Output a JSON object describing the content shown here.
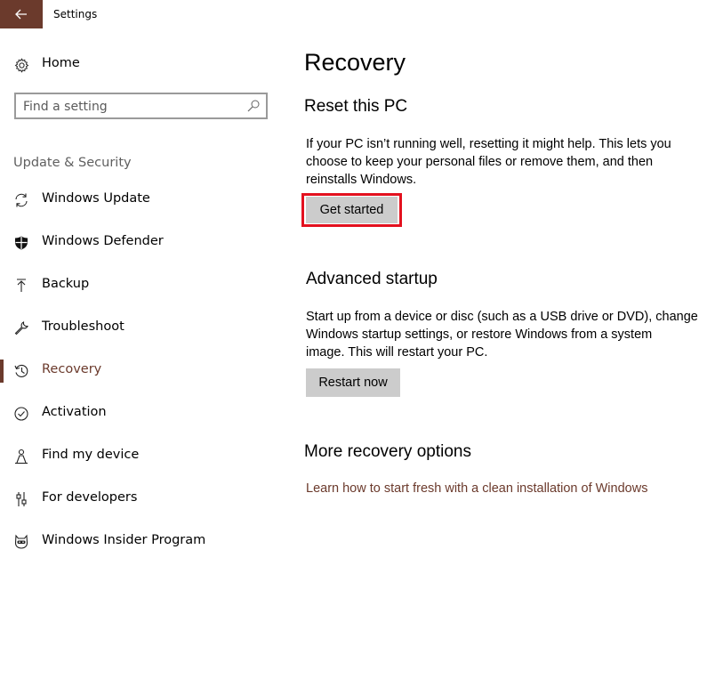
{
  "window": {
    "title": "Settings"
  },
  "colors": {
    "accent": "#6b3a2c",
    "highlight": "#e3111f",
    "button_bg": "#cccccc"
  },
  "sidebar": {
    "home_label": "Home",
    "search_placeholder": "Find a setting",
    "section_heading": "Update & Security",
    "items": [
      {
        "label": "Windows Update",
        "icon": "sync-icon"
      },
      {
        "label": "Windows Defender",
        "icon": "shield-icon"
      },
      {
        "label": "Backup",
        "icon": "upload-arrow-icon"
      },
      {
        "label": "Troubleshoot",
        "icon": "wrench-icon"
      },
      {
        "label": "Recovery",
        "icon": "history-icon",
        "selected": true
      },
      {
        "label": "Activation",
        "icon": "check-circle-icon"
      },
      {
        "label": "Find my device",
        "icon": "person-locate-icon"
      },
      {
        "label": "For developers",
        "icon": "developer-tools-icon"
      },
      {
        "label": "Windows Insider Program",
        "icon": "ninja-cat-icon"
      }
    ]
  },
  "main": {
    "title": "Recovery",
    "reset": {
      "heading": "Reset this PC",
      "description_lines": [
        "If your PC isn’t running well, resetting it might help. This lets you",
        "choose to keep your personal files or remove them, and then",
        "reinstalls Windows."
      ],
      "button_label": "Get started"
    },
    "advanced": {
      "heading": "Advanced startup",
      "description_lines": [
        "Start up from a device or disc (such as a USB drive or DVD), change",
        "Windows startup settings, or restore Windows from a system",
        "image. This will restart your PC."
      ],
      "button_label": "Restart now"
    },
    "more": {
      "heading": "More recovery options",
      "link_label": "Learn how to start fresh with a clean installation of Windows"
    }
  }
}
